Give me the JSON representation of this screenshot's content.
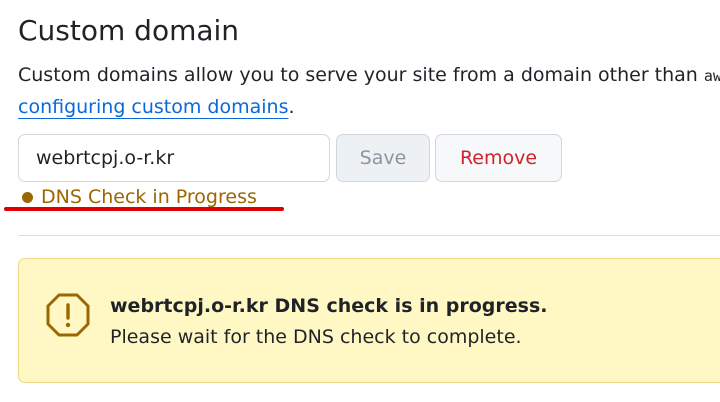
{
  "section": {
    "title": "Custom domain",
    "description_prefix": "Custom domains allow you to serve your site from a domain other than ",
    "description_code": "awsc",
    "link_text": "configuring custom domains",
    "link_suffix": "."
  },
  "form": {
    "domain_value": "webrtcpj.o-r.kr",
    "save_label": "Save",
    "remove_label": "Remove"
  },
  "status": {
    "text": "DNS Check in Progress",
    "color": "#9a6700"
  },
  "flash": {
    "icon": "alert-octagon-icon",
    "title": "webrtcpj.o-r.kr DNS check is in progress.",
    "body": "Please wait for the DNS check to complete."
  },
  "colors": {
    "link": "#0969da",
    "danger": "#cf222e",
    "warning_bg": "#fff8c5",
    "annotation": "#e00000"
  }
}
